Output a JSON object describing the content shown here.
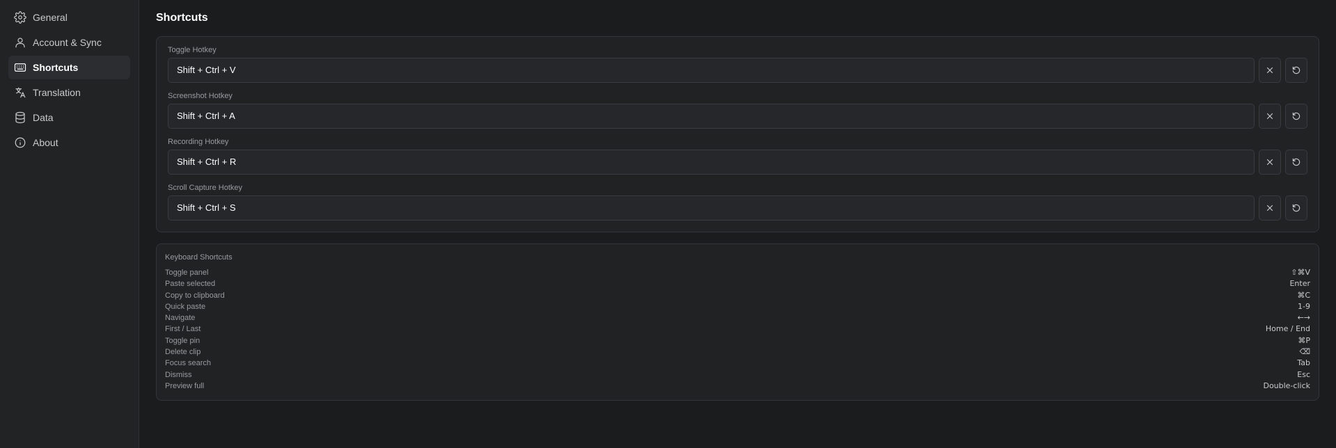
{
  "sidebar": {
    "items": [
      {
        "label": "General",
        "icon": "gear-icon"
      },
      {
        "label": "Account & Sync",
        "icon": "user-icon"
      },
      {
        "label": "Shortcuts",
        "icon": "keyboard-icon",
        "active": true
      },
      {
        "label": "Translation",
        "icon": "translate-icon"
      },
      {
        "label": "Data",
        "icon": "database-icon"
      },
      {
        "label": "About",
        "icon": "info-icon"
      }
    ]
  },
  "main": {
    "title": "Shortcuts",
    "hotkeys": [
      {
        "label": "Toggle Hotkey",
        "value": "Shift + Ctrl + V"
      },
      {
        "label": "Screenshot Hotkey",
        "value": "Shift + Ctrl + A"
      },
      {
        "label": "Recording Hotkey",
        "value": "Shift + Ctrl + R"
      },
      {
        "label": "Scroll Capture Hotkey",
        "value": "Shift + Ctrl + S"
      }
    ],
    "keyboard": {
      "title": "Keyboard Shortcuts",
      "rows": [
        {
          "action": "Toggle panel",
          "key": "⇧⌘V"
        },
        {
          "action": "Paste selected",
          "key": "Enter"
        },
        {
          "action": "Copy to clipboard",
          "key": "⌘C"
        },
        {
          "action": "Quick paste",
          "key": "1-9"
        },
        {
          "action": "Navigate",
          "key": "←→"
        },
        {
          "action": "First / Last",
          "key": "Home / End"
        },
        {
          "action": "Toggle pin",
          "key": "⌘P"
        },
        {
          "action": "Delete clip",
          "key": "⌫"
        },
        {
          "action": "Focus search",
          "key": "Tab"
        },
        {
          "action": "Dismiss",
          "key": "Esc"
        },
        {
          "action": "Preview full",
          "key": "Double-click"
        }
      ]
    }
  },
  "colors": {
    "background": "#1b1c1e",
    "sidebar": "#222325",
    "card": "#212224",
    "active_item": "#2c2d30"
  }
}
